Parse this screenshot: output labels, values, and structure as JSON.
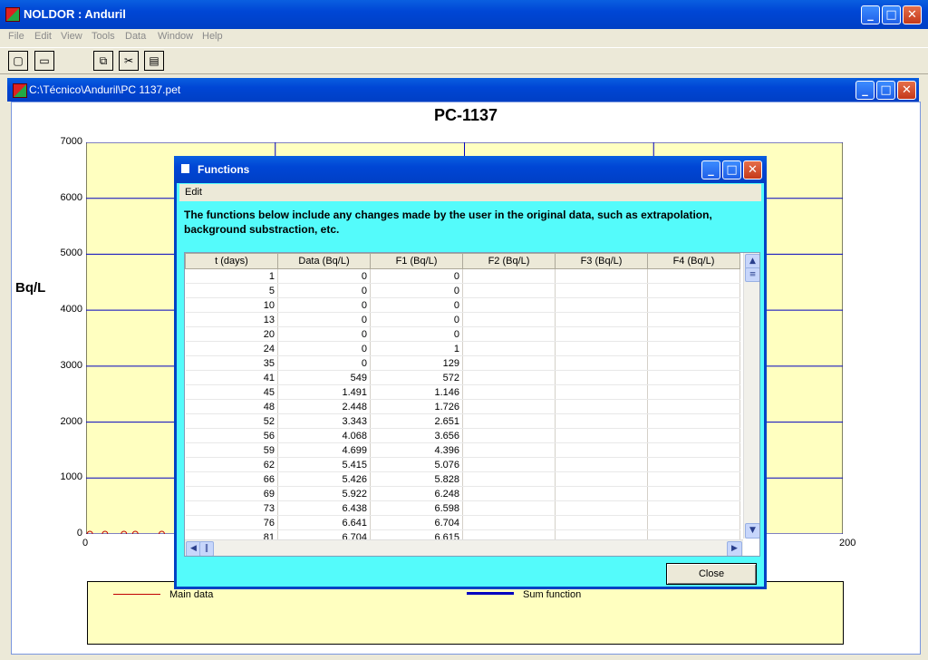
{
  "app": {
    "title": "NOLDOR : Anduril",
    "menu": [
      "File",
      "Edit",
      "View",
      "Tools",
      "Data",
      "Window",
      "Help"
    ],
    "window_buttons": {
      "minimize": "_",
      "maximize": "□",
      "close": "✕"
    }
  },
  "child_window": {
    "title": "C:\\Técnico\\Anduril\\PC 1137.pet"
  },
  "chart_data": {
    "type": "scatter",
    "title": "PC-1137",
    "ylabel": "Bq/L",
    "xlabel": "",
    "xlim": [
      0,
      200
    ],
    "ylim": [
      0,
      7000
    ],
    "y_ticks": [
      "7000",
      "6000",
      "5000",
      "4000",
      "3000",
      "2000",
      "1000",
      "0"
    ],
    "x_ticks": [
      "0",
      "200"
    ],
    "grid": true,
    "background": "#ffffc0",
    "series": [
      {
        "name": "Main data",
        "color": "#c00000",
        "x": [
          1,
          5,
          10,
          13,
          20
        ],
        "y": [
          0,
          0,
          0,
          0,
          0
        ]
      }
    ],
    "legend": [
      "Main data",
      "Sum function"
    ]
  },
  "dialog": {
    "title": "Functions",
    "menu_edit": "Edit",
    "notice": "The functions below include any changes made by the user in the original data, such as extrapolation, background substraction, etc.",
    "columns": [
      "t (days)",
      "Data (Bq/L)",
      "F1 (Bq/L)",
      "F2 (Bq/L)",
      "F3 (Bq/L)",
      "F4 (Bq/L)"
    ],
    "rows": [
      [
        "1",
        "0",
        "0",
        "",
        "",
        ""
      ],
      [
        "5",
        "0",
        "0",
        "",
        "",
        ""
      ],
      [
        "10",
        "0",
        "0",
        "",
        "",
        ""
      ],
      [
        "13",
        "0",
        "0",
        "",
        "",
        ""
      ],
      [
        "20",
        "0",
        "0",
        "",
        "",
        ""
      ],
      [
        "24",
        "0",
        "1",
        "",
        "",
        ""
      ],
      [
        "35",
        "0",
        "129",
        "",
        "",
        ""
      ],
      [
        "41",
        "549",
        "572",
        "",
        "",
        ""
      ],
      [
        "45",
        "1.491",
        "1.146",
        "",
        "",
        ""
      ],
      [
        "48",
        "2.448",
        "1.726",
        "",
        "",
        ""
      ],
      [
        "52",
        "3.343",
        "2.651",
        "",
        "",
        ""
      ],
      [
        "56",
        "4.068",
        "3.656",
        "",
        "",
        ""
      ],
      [
        "59",
        "4.699",
        "4.396",
        "",
        "",
        ""
      ],
      [
        "62",
        "5.415",
        "5.076",
        "",
        "",
        ""
      ],
      [
        "66",
        "5.426",
        "5.828",
        "",
        "",
        ""
      ],
      [
        "69",
        "5.922",
        "6.248",
        "",
        "",
        ""
      ],
      [
        "73",
        "6.438",
        "6.598",
        "",
        "",
        ""
      ],
      [
        "76",
        "6.641",
        "6.704",
        "",
        "",
        ""
      ],
      [
        "81",
        "6.704",
        "6.615",
        "",
        "",
        ""
      ]
    ],
    "close_label": "Close"
  }
}
